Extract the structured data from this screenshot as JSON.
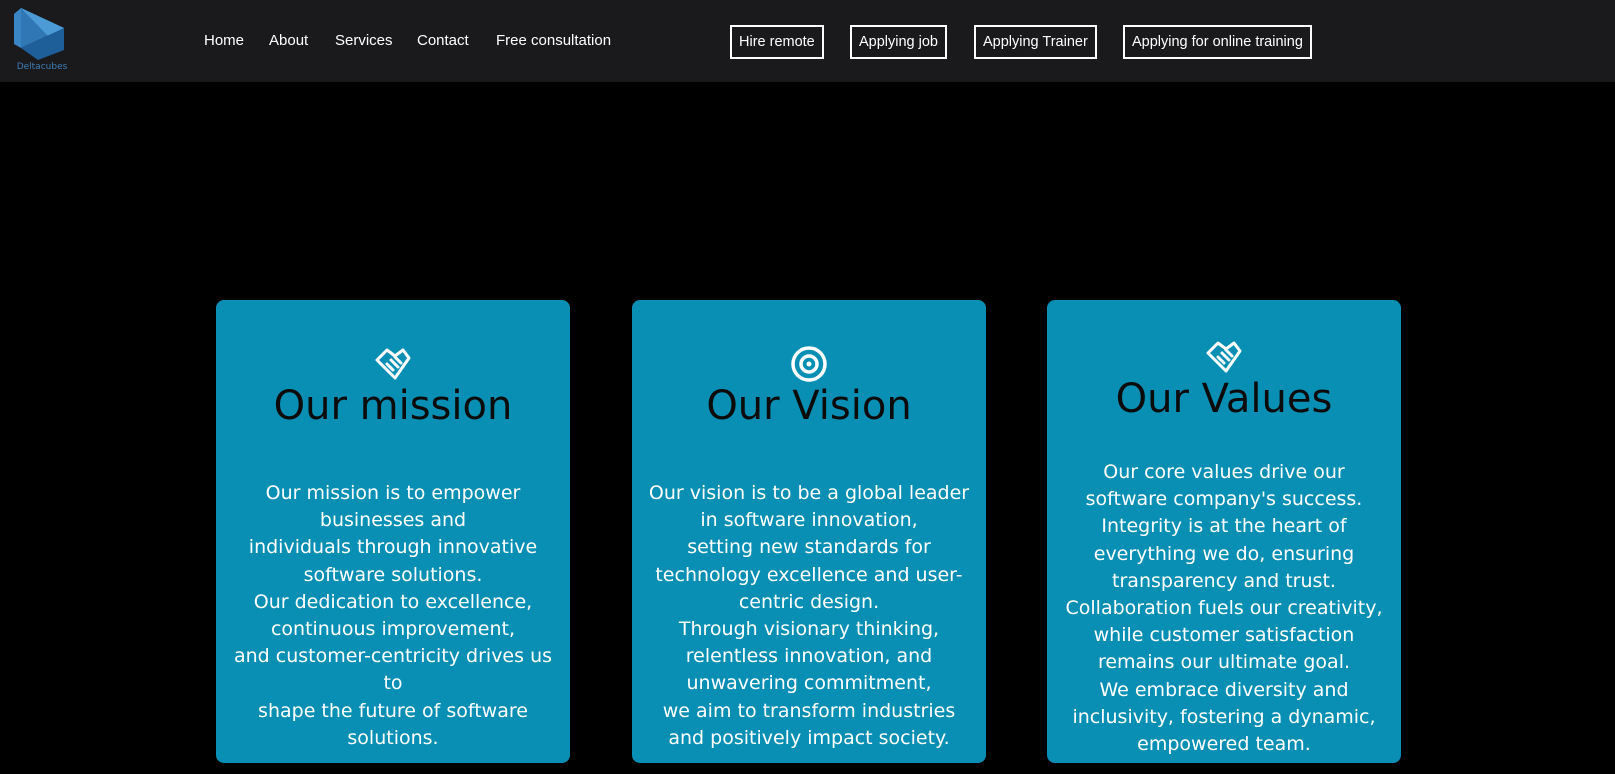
{
  "brand": {
    "name": "Deltacubes",
    "tagline": "",
    "logo_color": "#3f8cc9"
  },
  "nav": {
    "links": [
      "Home",
      "About",
      "Services",
      "Contact",
      "Free consultation"
    ]
  },
  "actions": {
    "buttons": [
      "Hire remote",
      "Applying job",
      "Applying Trainer",
      "Applying for online training"
    ]
  },
  "cards": [
    {
      "icon": "handshake-icon",
      "title": "Our mission",
      "body": "Our mission is to empower\nbusinesses and\nindividuals through innovative\nsoftware solutions.\nOur dedication to excellence,\ncontinuous improvement,\nand customer-centricity drives us\nto\nshape the future of software\nsolutions."
    },
    {
      "icon": "target-icon",
      "title": "Our Vision",
      "body": "Our vision is to be a global leader\nin software innovation,\nsetting new standards for\ntechnology excellence and user-\ncentric design.\nThrough visionary thinking,\nrelentless innovation, and\nunwavering commitment,\nwe aim to transform industries\nand positively impact society."
    },
    {
      "icon": "handshake-icon",
      "title": "Our Values",
      "body": "Our core values drive our\nsoftware company's success.\nIntegrity is at the heart of\neverything we do, ensuring\ntransparency and trust.\nCollaboration fuels our creativity,\nwhile customer satisfaction\nremains our ultimate goal.\nWe embrace diversity and\ninclusivity, fostering a dynamic,\nempowered team."
    }
  ],
  "colors": {
    "topbar": "#1a1a1c",
    "page_bg": "#000000",
    "card_bg": "#088fb3",
    "card_title": "#0b0b0b"
  }
}
